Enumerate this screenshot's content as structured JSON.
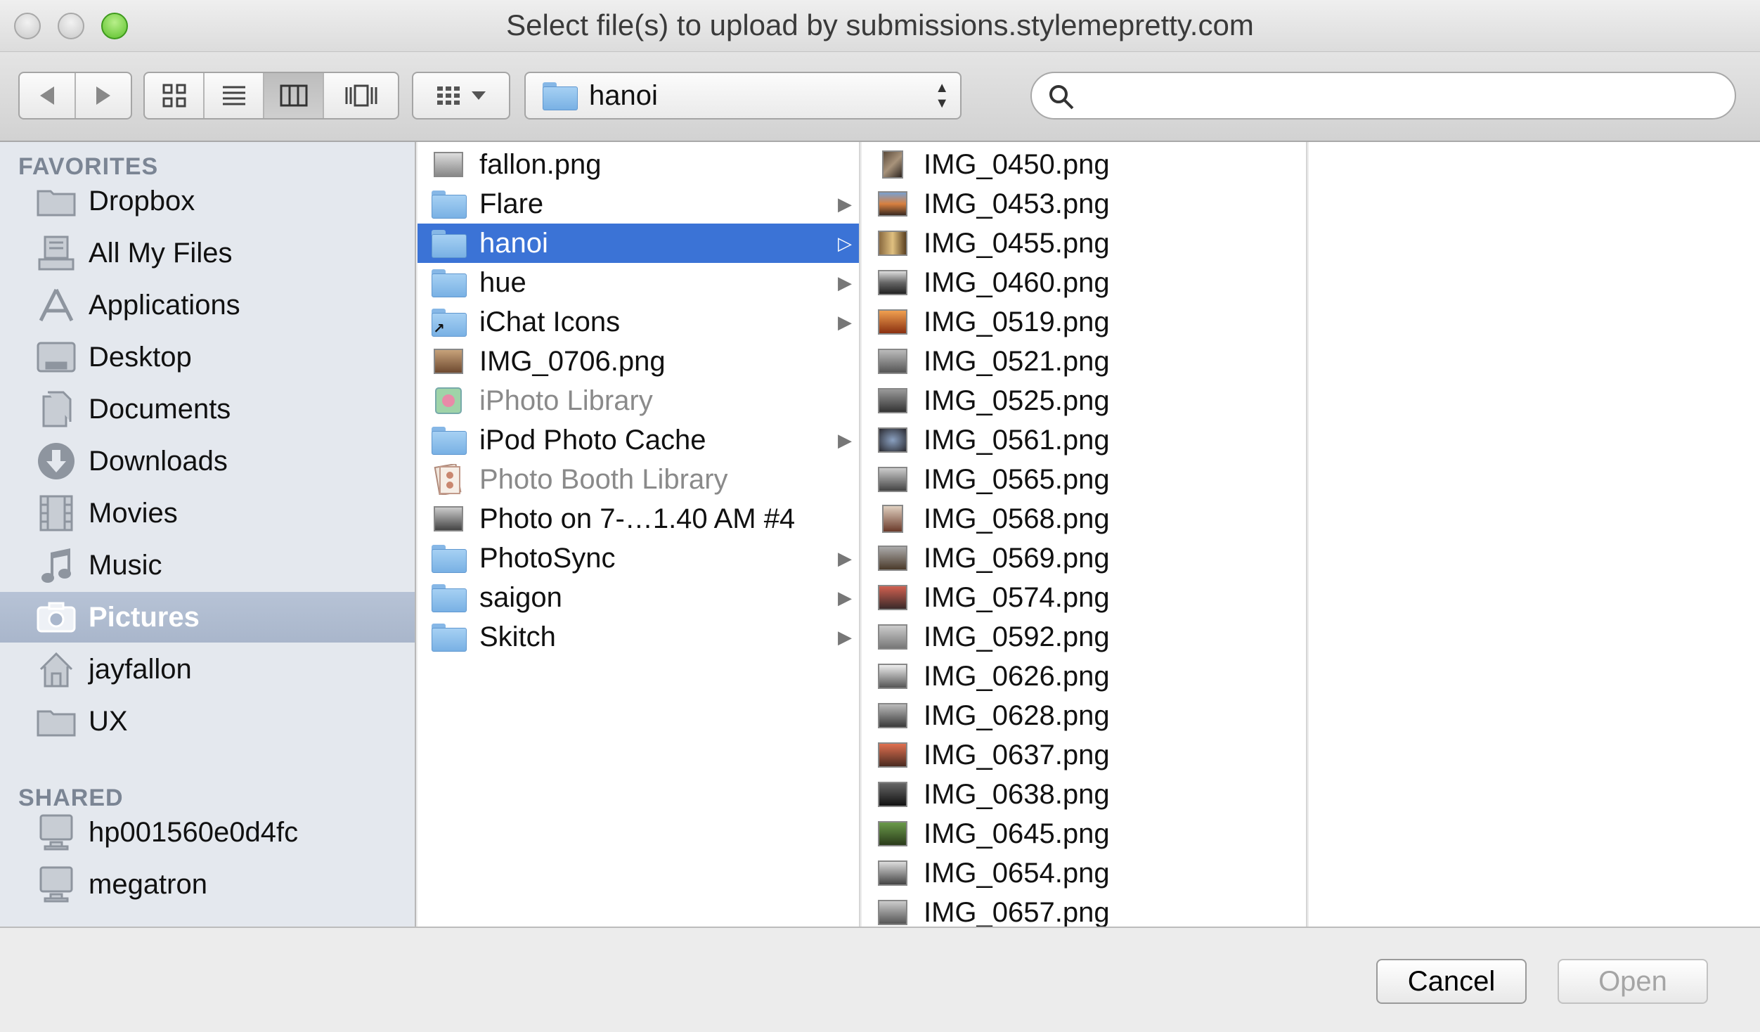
{
  "window": {
    "title": "Select file(s) to upload by submissions.stylemepretty.com"
  },
  "toolbar": {
    "location": "hanoi",
    "search": {
      "value": "",
      "placeholder": ""
    }
  },
  "sidebar": {
    "favorites_header": "FAVORITES",
    "favorites": [
      {
        "label": "Dropbox",
        "icon": "folder-icon"
      },
      {
        "label": "All My Files",
        "icon": "all-files-icon"
      },
      {
        "label": "Applications",
        "icon": "applications-icon"
      },
      {
        "label": "Desktop",
        "icon": "desktop-icon"
      },
      {
        "label": "Documents",
        "icon": "documents-icon"
      },
      {
        "label": "Downloads",
        "icon": "downloads-icon"
      },
      {
        "label": "Movies",
        "icon": "movies-icon"
      },
      {
        "label": "Music",
        "icon": "music-icon"
      },
      {
        "label": "Pictures",
        "icon": "camera-icon",
        "selected": true
      },
      {
        "label": "jayfallon",
        "icon": "home-icon"
      },
      {
        "label": "UX",
        "icon": "folder-icon"
      }
    ],
    "shared_header": "SHARED",
    "shared": [
      {
        "label": "hp001560e0d4fc",
        "icon": "computer-icon"
      },
      {
        "label": "megatron",
        "icon": "computer-icon"
      }
    ]
  },
  "columns": {
    "pictures": [
      {
        "label": "fallon.png",
        "kind": "image"
      },
      {
        "label": "Flare",
        "kind": "folder",
        "has_children": true
      },
      {
        "label": "hanoi",
        "kind": "folder",
        "has_children": true,
        "selected": true
      },
      {
        "label": "hue",
        "kind": "folder",
        "has_children": true
      },
      {
        "label": "iChat Icons",
        "kind": "alias-folder",
        "has_children": true
      },
      {
        "label": "IMG_0706.png",
        "kind": "image"
      },
      {
        "label": "iPhoto Library",
        "kind": "library",
        "dimmed": true
      },
      {
        "label": "iPod Photo Cache",
        "kind": "folder",
        "has_children": true
      },
      {
        "label": "Photo Booth Library",
        "kind": "library",
        "dimmed": true
      },
      {
        "label": "Photo on 7-…1.40 AM #4",
        "kind": "image"
      },
      {
        "label": "PhotoSync",
        "kind": "folder",
        "has_children": true
      },
      {
        "label": "saigon",
        "kind": "folder",
        "has_children": true
      },
      {
        "label": "Skitch",
        "kind": "folder",
        "has_children": true
      }
    ],
    "hanoi": [
      {
        "label": "IMG_0450.png",
        "kind": "image"
      },
      {
        "label": "IMG_0453.png",
        "kind": "image"
      },
      {
        "label": "IMG_0455.png",
        "kind": "image"
      },
      {
        "label": "IMG_0460.png",
        "kind": "image"
      },
      {
        "label": "IMG_0519.png",
        "kind": "image"
      },
      {
        "label": "IMG_0521.png",
        "kind": "image"
      },
      {
        "label": "IMG_0525.png",
        "kind": "image"
      },
      {
        "label": "IMG_0561.png",
        "kind": "image"
      },
      {
        "label": "IMG_0565.png",
        "kind": "image"
      },
      {
        "label": "IMG_0568.png",
        "kind": "image"
      },
      {
        "label": "IMG_0569.png",
        "kind": "image"
      },
      {
        "label": "IMG_0574.png",
        "kind": "image"
      },
      {
        "label": "IMG_0592.png",
        "kind": "image"
      },
      {
        "label": "IMG_0626.png",
        "kind": "image"
      },
      {
        "label": "IMG_0628.png",
        "kind": "image"
      },
      {
        "label": "IMG_0637.png",
        "kind": "image"
      },
      {
        "label": "IMG_0638.png",
        "kind": "image"
      },
      {
        "label": "IMG_0645.png",
        "kind": "image"
      },
      {
        "label": "IMG_0654.png",
        "kind": "image"
      },
      {
        "label": "IMG_0657.png",
        "kind": "image"
      }
    ]
  },
  "buttons": {
    "cancel": "Cancel",
    "open": "Open"
  },
  "colors": {
    "selection": "#3b73d6",
    "sidebar_bg": "#e4e8ee",
    "sidebar_selection": "#aab7cc"
  }
}
